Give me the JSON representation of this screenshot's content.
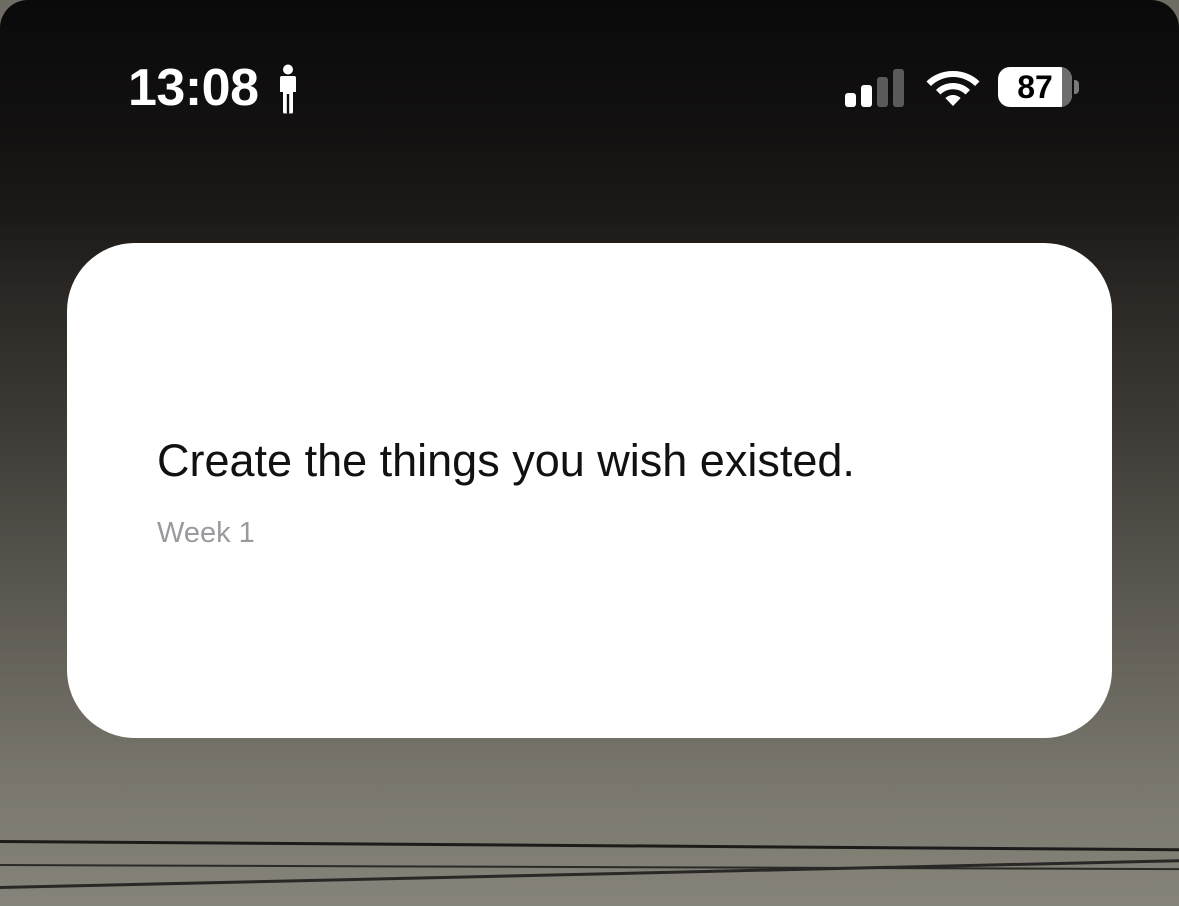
{
  "status_bar": {
    "time": "13:08",
    "focus_icon": "person-standing-icon",
    "signal_icon": "cellular-signal-icon",
    "signal_bars_active": 2,
    "signal_bars_total": 4,
    "wifi_icon": "wifi-icon",
    "battery_icon": "battery-icon",
    "battery_percent": "87",
    "battery_level": 0.87
  },
  "widget": {
    "quote": "Create the things you wish existed.",
    "subtitle": "Week 1"
  },
  "colors": {
    "widget_background": "#ffffff",
    "quote_text": "#111111",
    "subtitle_text": "#9a9a9e",
    "status_text": "#ffffff"
  }
}
